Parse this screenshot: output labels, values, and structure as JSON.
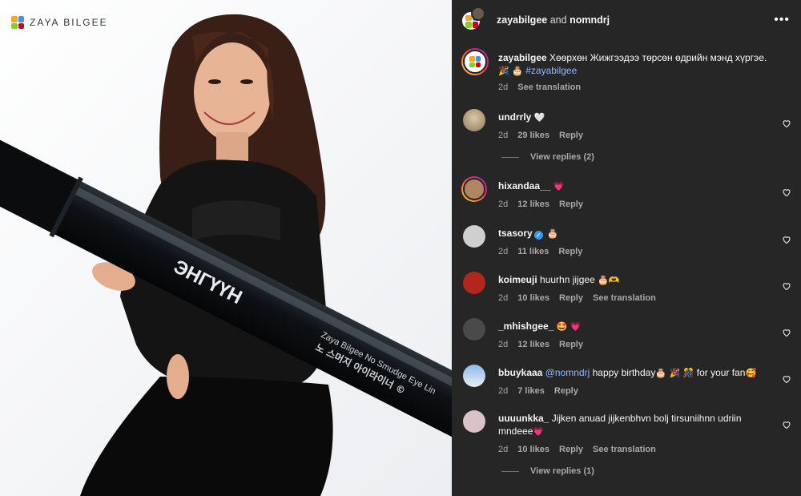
{
  "brand": {
    "name": "ZAYA BILGEE"
  },
  "product": {
    "label": "ЭНГҮҮН",
    "line1": "Zaya Bilgee No Smudge Eye Lin",
    "line2": "노 스머지 아이라이너 ©"
  },
  "header": {
    "user1": "zayabilgee",
    "and": "and",
    "user2": "nomndrj"
  },
  "caption": {
    "username": "zayabilgee",
    "text": "Хөөрхөн Жижгээдээ төрсөн өдрийн мэнд хүргэе.",
    "emoji": "🎉 🎂",
    "hashtag": "#zayabilgee",
    "time": "2d",
    "translate": "See translation"
  },
  "comments": [
    {
      "username": "undrrly",
      "text": "",
      "emoji": "🤍",
      "time": "2d",
      "likes": "29 likes",
      "reply": "Reply",
      "translate": "",
      "view_replies": "View replies (2)"
    },
    {
      "username": "hixandaa__",
      "text": "",
      "emoji": "💗",
      "time": "2d",
      "likes": "12 likes",
      "reply": "Reply",
      "translate": "",
      "view_replies": ""
    },
    {
      "username": "tsasory",
      "text": "",
      "emoji": "🎂",
      "time": "2d",
      "likes": "11 likes",
      "reply": "Reply",
      "translate": "",
      "view_replies": ""
    },
    {
      "username": "koimeuji",
      "text": "huurhn jijgee",
      "emoji": "🎂🫶",
      "time": "2d",
      "likes": "10 likes",
      "reply": "Reply",
      "translate": "See translation",
      "view_replies": ""
    },
    {
      "username": "_mhishgee_",
      "text": "",
      "emoji": "🤩 💗",
      "time": "2d",
      "likes": "12 likes",
      "reply": "Reply",
      "translate": "",
      "view_replies": ""
    },
    {
      "username": "bbuykaaa",
      "mention": "@nomndrj",
      "text": "happy birthday",
      "emoji": "🎂 🎉 🎊",
      "text2": "for your fan",
      "emoji2": "🥰",
      "time": "2d",
      "likes": "7 likes",
      "reply": "Reply",
      "translate": "",
      "view_replies": ""
    },
    {
      "username": "uuuunkka_",
      "text": "Jijken anuad jijkenbhvn bolj tirsuniihnn udriin mndeee",
      "emoji": "💗",
      "time": "2d",
      "likes": "10 likes",
      "reply": "Reply",
      "translate": "See translation",
      "view_replies": "View replies (1)"
    }
  ],
  "icons": {
    "more": "more-horizontal-icon",
    "like": "heart-outline-icon",
    "verified": "verified-badge-icon"
  },
  "colors": {
    "panel_bg": "#262626",
    "text": "#f5f5f5",
    "muted": "#a8a8a8",
    "hashtag": "#93b8ff",
    "verified": "#3897f0"
  }
}
